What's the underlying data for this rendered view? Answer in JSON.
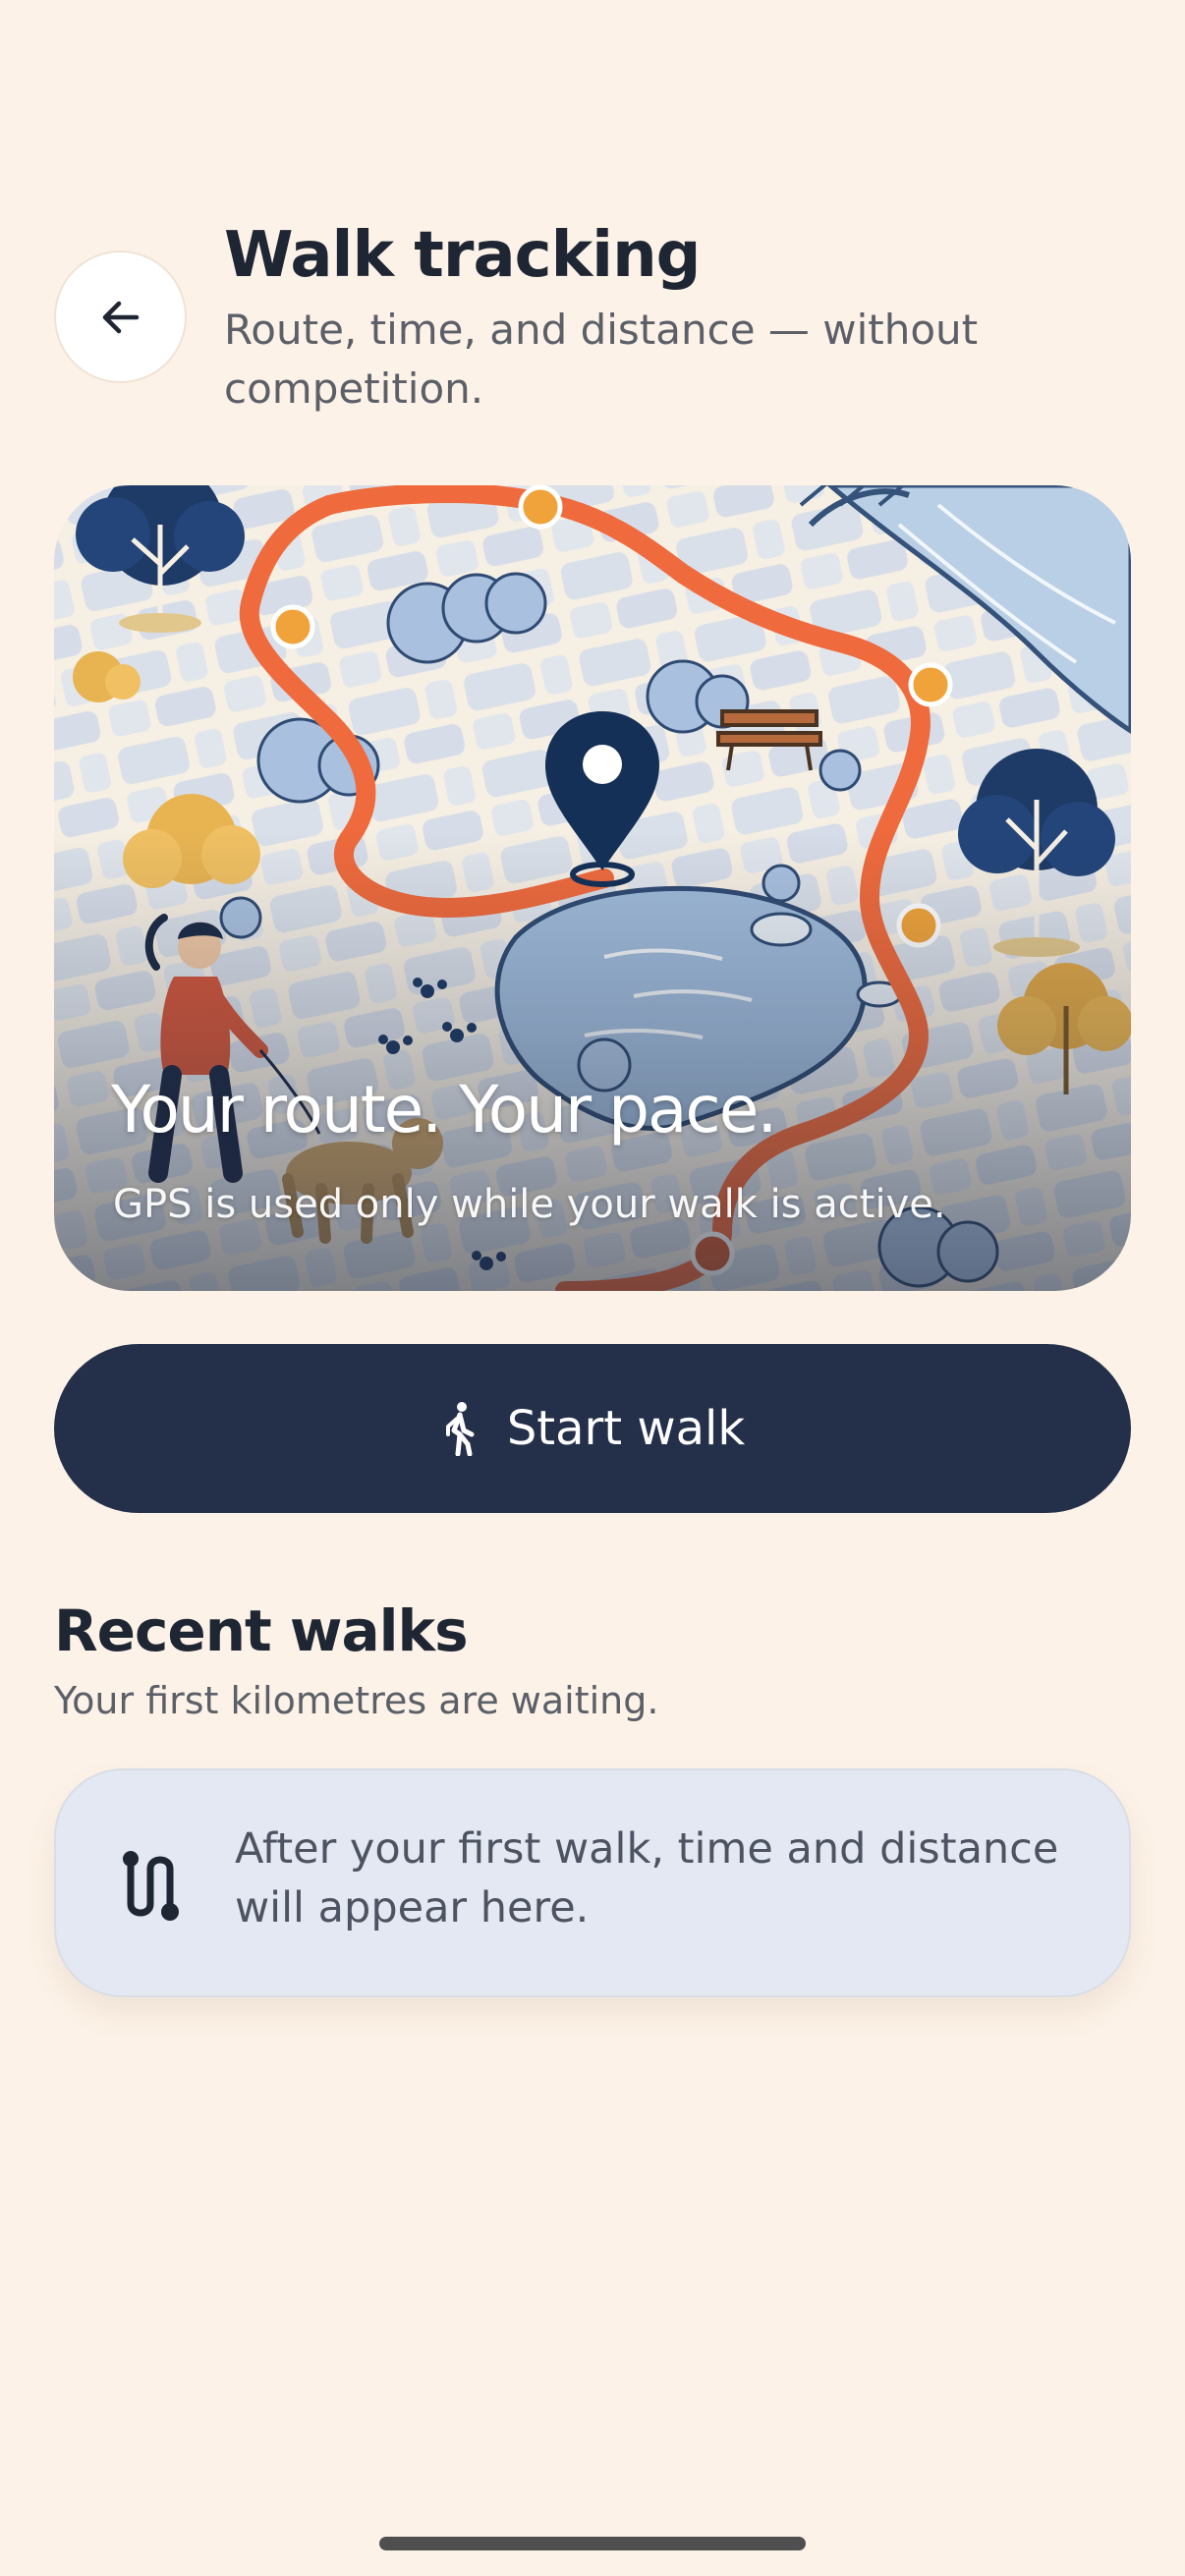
{
  "header": {
    "back_icon": "arrow-left-icon",
    "title": "Walk tracking",
    "subtitle": "Route, time, and distance — without competition."
  },
  "hero": {
    "headline": "Your route. Your pace.",
    "caption": "GPS is used only while your walk is active.",
    "colors": {
      "route": "#ef6a3c",
      "waypoint": "#f0a33a",
      "pin": "#143057",
      "water": "#a9c4df"
    }
  },
  "actions": {
    "start_icon": "walking-person-icon",
    "start_label": "Start walk"
  },
  "recent": {
    "title": "Recent walks",
    "subtitle": "Your first kilometres are waiting.",
    "empty_icon": "route-icon",
    "empty_text": "After your first walk, time and distance will appear here."
  },
  "colors": {
    "background": "#fdf2e7",
    "primary": "#24304a",
    "card": "#e3e8f2"
  }
}
